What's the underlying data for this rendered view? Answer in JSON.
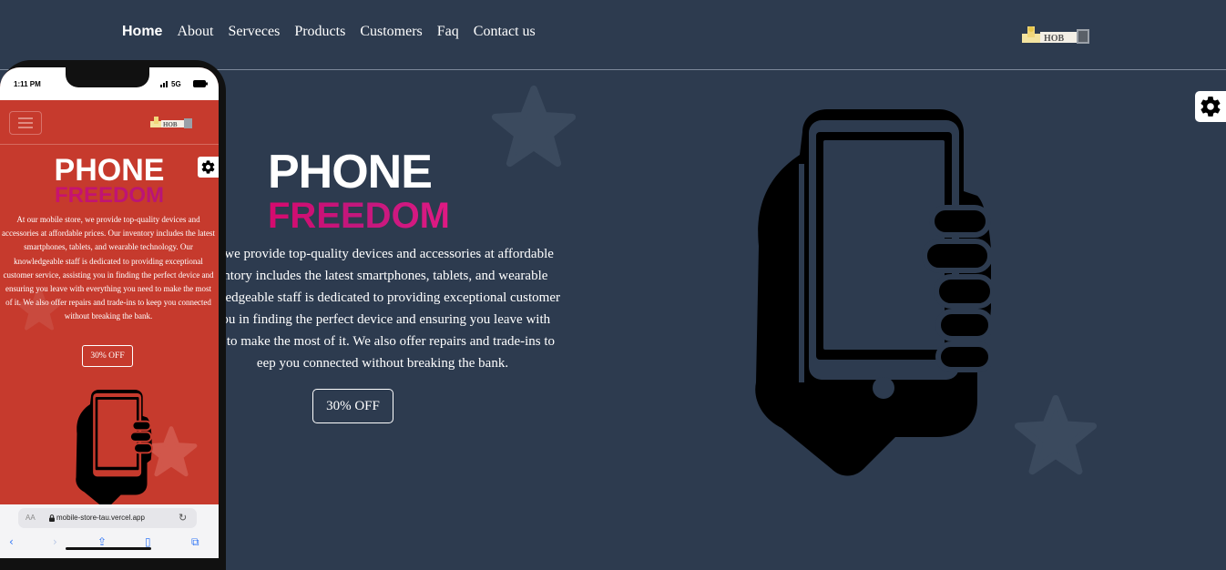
{
  "nav": {
    "items": [
      "Home",
      "About",
      "Serveces",
      "Products",
      "Customers",
      "Faq",
      "Contact us"
    ]
  },
  "logo": {
    "text": "HOB"
  },
  "hero": {
    "title_line1": "PHONE",
    "title_line2": "FREEDOM",
    "text": "e, we provide top-quality devices and accessories at affordable\nentory includes the latest smartphones, tablets, and wearable\nowledgeable staff is dedicated to providing exceptional customer\nyou in finding the perfect device and ensuring you leave with\ned to make the most of it. We also offer repairs and trade-ins to\neep you connected without breaking the bank.",
    "button": "30% OFF"
  },
  "mobile": {
    "time": "1:11 PM",
    "network": "5G",
    "title_line1": "PHONE",
    "title_line2": "FREEDOM",
    "text": "At our mobile store, we provide top-quality devices and accessories at affordable prices. Our inventory includes the latest smartphones, tablets, and wearable technology. Our knowledgeable staff is dedicated to providing exceptional customer service, assisting you in finding the perfect device and ensuring you leave with everything you need to make the most of it. We also offer repairs and trade-ins to keep you connected without breaking the bank.",
    "button": "30% OFF",
    "url_aa": "AA",
    "url": "mobile-store-tau.vercel.app"
  },
  "colors": {
    "page_bg": "#2d3b4f",
    "mobile_bg": "#c63a2d",
    "accent_pink": "#d60a6e"
  },
  "icons": [
    "settings-gear-icon",
    "hamburger-menu-icon",
    "phone-in-hand-icon",
    "star-icon",
    "lock-icon",
    "reload-icon",
    "back-icon",
    "forward-icon",
    "share-icon",
    "bookmarks-icon",
    "tabs-icon"
  ]
}
